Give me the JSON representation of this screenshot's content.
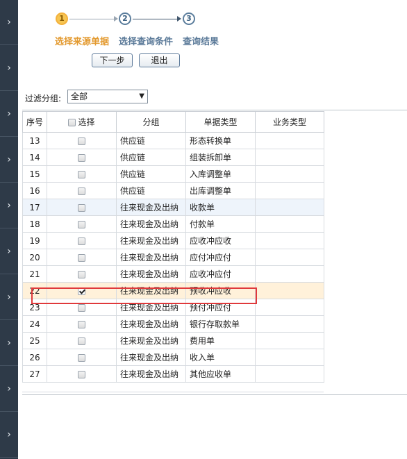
{
  "sidebar": {
    "tab_glyph": "›",
    "tab_count": 10
  },
  "steps": [
    {
      "num": "1",
      "label": "选择来源单据",
      "state": "active"
    },
    {
      "num": "2",
      "label": "选择查询条件",
      "state": "idle"
    },
    {
      "num": "3",
      "label": "查询结果",
      "state": "idle"
    }
  ],
  "buttons": {
    "next": "下一步",
    "exit": "退出"
  },
  "filter": {
    "label": "过滤分组:",
    "value": "全部",
    "caret": "▼"
  },
  "table": {
    "headers": {
      "no": "序号",
      "select": "选择",
      "group": "分组",
      "doc_type": "单据类型",
      "biz_type": "业务类型"
    },
    "rows": [
      {
        "no": "13",
        "checked": false,
        "group": "供应链",
        "doc_type": "形态转换单",
        "biz_type": ""
      },
      {
        "no": "14",
        "checked": false,
        "group": "供应链",
        "doc_type": "组装拆卸单",
        "biz_type": ""
      },
      {
        "no": "15",
        "checked": false,
        "group": "供应链",
        "doc_type": "入库调整单",
        "biz_type": ""
      },
      {
        "no": "16",
        "checked": false,
        "group": "供应链",
        "doc_type": "出库调整单",
        "biz_type": ""
      },
      {
        "no": "17",
        "checked": false,
        "group": "往来现金及出纳",
        "doc_type": "收款单",
        "biz_type": ""
      },
      {
        "no": "18",
        "checked": false,
        "group": "往来现金及出纳",
        "doc_type": "付款单",
        "biz_type": ""
      },
      {
        "no": "19",
        "checked": false,
        "group": "往来现金及出纳",
        "doc_type": "应收冲应收",
        "biz_type": ""
      },
      {
        "no": "20",
        "checked": false,
        "group": "往来现金及出纳",
        "doc_type": "应付冲应付",
        "biz_type": ""
      },
      {
        "no": "21",
        "checked": false,
        "group": "往来现金及出纳",
        "doc_type": "应收冲应付",
        "biz_type": ""
      },
      {
        "no": "22",
        "checked": true,
        "group": "往来现金及出纳",
        "doc_type": "预收冲应收",
        "biz_type": ""
      },
      {
        "no": "23",
        "checked": false,
        "group": "往来现金及出纳",
        "doc_type": "预付冲应付",
        "biz_type": ""
      },
      {
        "no": "24",
        "checked": false,
        "group": "往来现金及出纳",
        "doc_type": "银行存取款单",
        "biz_type": ""
      },
      {
        "no": "25",
        "checked": false,
        "group": "往来现金及出纳",
        "doc_type": "费用单",
        "biz_type": ""
      },
      {
        "no": "26",
        "checked": false,
        "group": "往来现金及出纳",
        "doc_type": "收入单",
        "biz_type": ""
      },
      {
        "no": "27",
        "checked": false,
        "group": "往来现金及出纳",
        "doc_type": "其他应收单",
        "biz_type": ""
      }
    ],
    "alt_row": "17",
    "highlight_row": "22"
  },
  "colors": {
    "sidebar": "#2e3a48",
    "step_active": "#e39a30",
    "step_idle": "#5b7a99",
    "highlight": "#e0393b"
  }
}
